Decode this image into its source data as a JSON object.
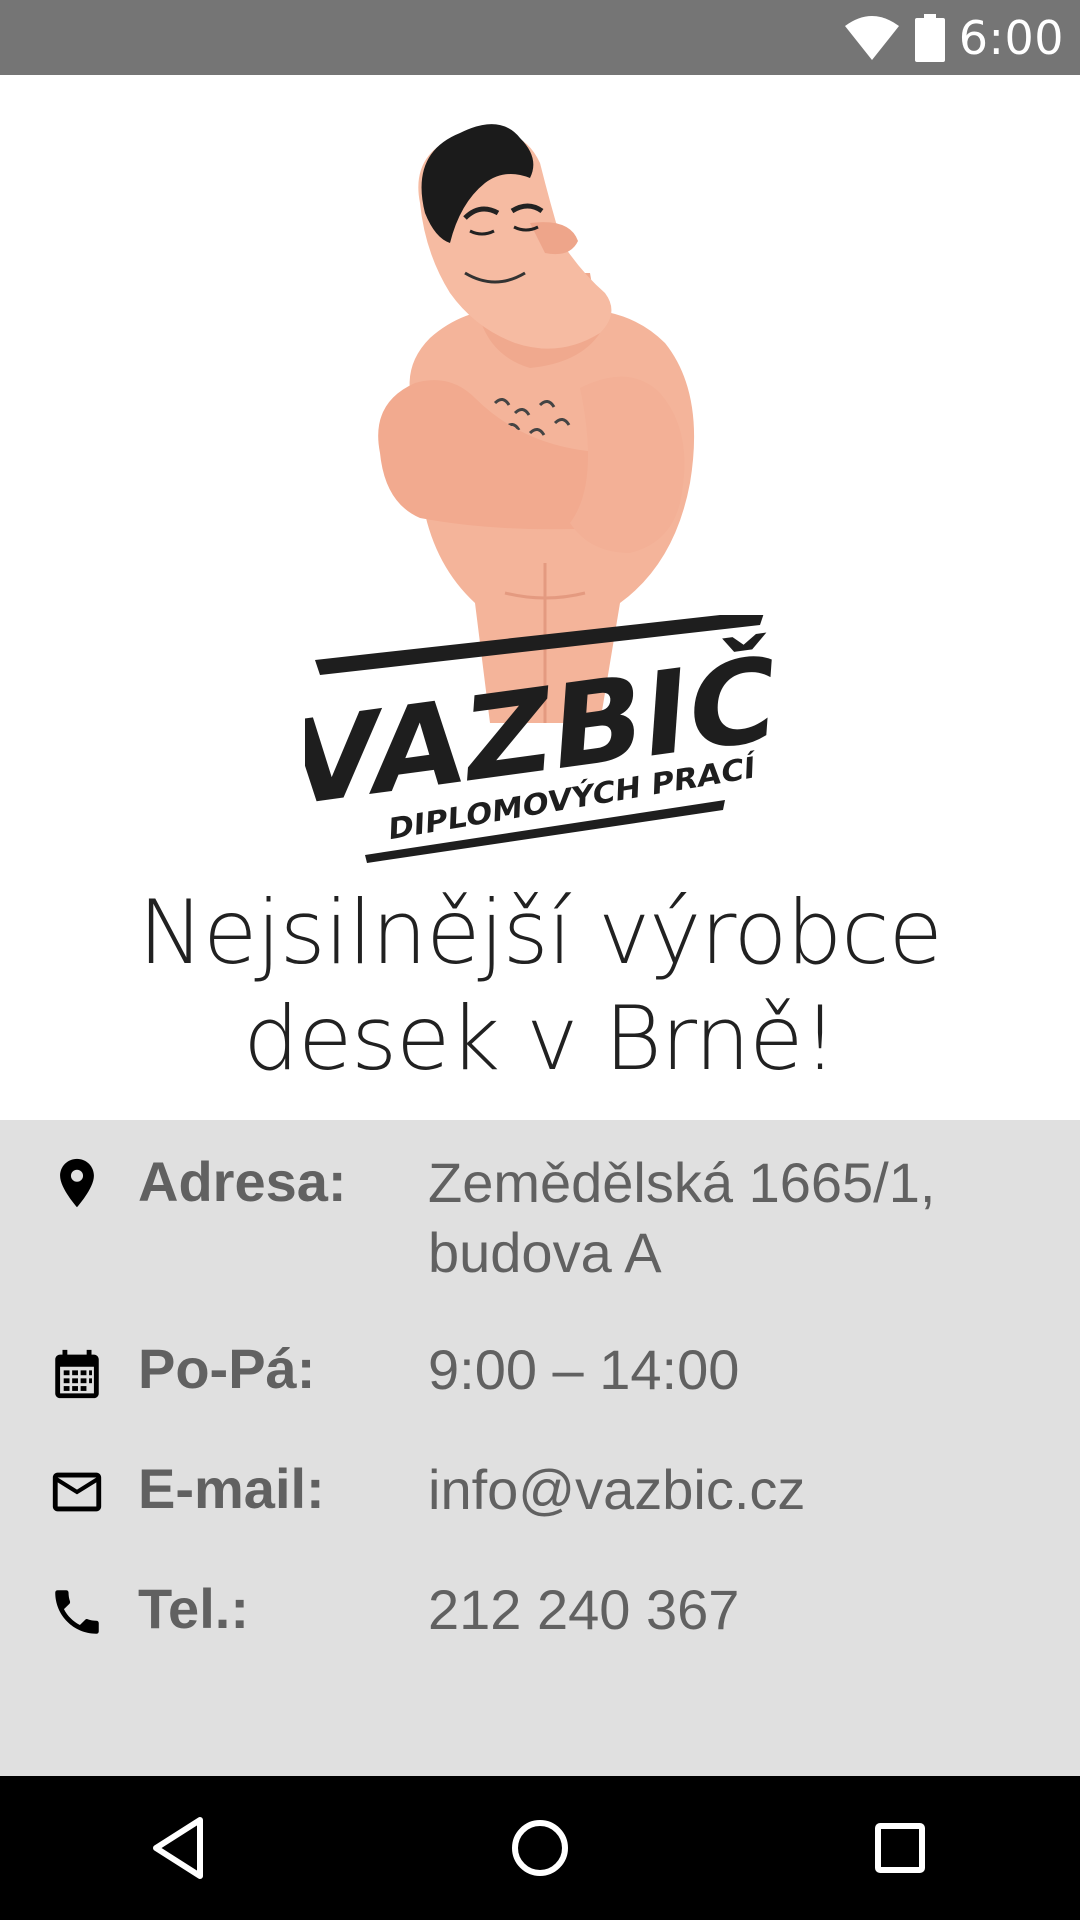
{
  "status_bar": {
    "time": "6:00",
    "icons": [
      "wifi-icon",
      "battery-icon"
    ]
  },
  "hero": {
    "logo_brand": "VAZBIČ",
    "logo_subtitle": "DIPLOMOVÝCH PRACÍ",
    "tagline_line1": "Nejsilnější výrobce",
    "tagline_line2": "desek v Brně!"
  },
  "info": {
    "address": {
      "icon": "location-pin-icon",
      "label": "Adresa:",
      "value_line1": "Zemědělská 1665/1,",
      "value_line2": "budova A"
    },
    "hours": {
      "icon": "calendar-icon",
      "label": "Po-Pá:",
      "value": "9:00 – 14:00"
    },
    "email": {
      "icon": "mail-icon",
      "label": "E-mail:",
      "value": "info@vazbic.cz"
    },
    "phone": {
      "icon": "phone-icon",
      "label": "Tel.:",
      "value": "212 240 367"
    }
  },
  "nav_bar": {
    "buttons": [
      "back-icon",
      "home-icon",
      "recents-icon"
    ]
  },
  "colors": {
    "status_bar": "#757575",
    "info_background": "#e0e0e0",
    "info_text": "#616161",
    "tagline_text": "#212121",
    "nav_bar": "#000000"
  }
}
